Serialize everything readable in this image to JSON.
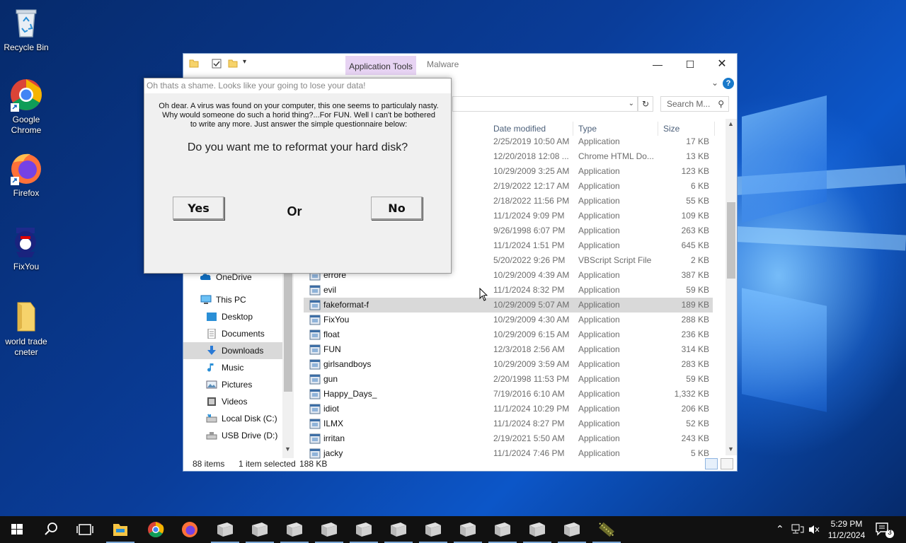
{
  "desktop": {
    "icons": [
      {
        "label": "Recycle Bin",
        "icon": "recycle-bin-icon"
      },
      {
        "label": "Google Chrome",
        "icon": "chrome-icon"
      },
      {
        "label": "Firefox",
        "icon": "firefox-icon"
      },
      {
        "label": "FixYou",
        "icon": "fixyou-icon"
      },
      {
        "label": "world trade cneter",
        "icon": "folder-icon"
      }
    ]
  },
  "explorer": {
    "ribbon_tab": "Application Tools",
    "title": "Malware",
    "search_placeholder": "Search M...",
    "columns": {
      "date": "Date modified",
      "type": "Type",
      "size": "Size"
    },
    "nav": [
      {
        "label": "OneDrive",
        "icon": "onedrive-icon"
      },
      {
        "label": "This PC",
        "icon": "pc-icon"
      },
      {
        "label": "Desktop",
        "icon": "desktop-icon"
      },
      {
        "label": "Documents",
        "icon": "documents-icon"
      },
      {
        "label": "Downloads",
        "icon": "downloads-icon",
        "selected": true
      },
      {
        "label": "Music",
        "icon": "music-icon"
      },
      {
        "label": "Pictures",
        "icon": "pictures-icon"
      },
      {
        "label": "Videos",
        "icon": "videos-icon"
      },
      {
        "label": "Local Disk (C:)",
        "icon": "drive-icon"
      },
      {
        "label": "USB Drive (D:)",
        "icon": "usb-drive-icon"
      }
    ],
    "files": [
      {
        "name": "",
        "date": "2/25/2019 10:50 AM",
        "type": "Application",
        "size": "17 KB"
      },
      {
        "name": "",
        "date": "12/20/2018 12:08 ...",
        "type": "Chrome HTML Do...",
        "size": "13 KB"
      },
      {
        "name": "",
        "date": "10/29/2009 3:25 AM",
        "type": "Application",
        "size": "123 KB"
      },
      {
        "name": "",
        "date": "2/19/2022 12:17 AM",
        "type": "Application",
        "size": "6 KB"
      },
      {
        "name": "",
        "date": "2/18/2022 11:56 PM",
        "type": "Application",
        "size": "55 KB"
      },
      {
        "name": "",
        "date": "11/1/2024 9:09 PM",
        "type": "Application",
        "size": "109 KB"
      },
      {
        "name": "",
        "date": "9/26/1998 6:07 PM",
        "type": "Application",
        "size": "263 KB"
      },
      {
        "name": "",
        "date": "11/1/2024 1:51 PM",
        "type": "Application",
        "size": "645 KB"
      },
      {
        "name": "",
        "date": "5/20/2022 9:26 PM",
        "type": "VBScript Script File",
        "size": "2 KB"
      },
      {
        "name": "errore",
        "date": "10/29/2009 4:39 AM",
        "type": "Application",
        "size": "387 KB"
      },
      {
        "name": "evil",
        "date": "11/1/2024 8:32 PM",
        "type": "Application",
        "size": "59 KB"
      },
      {
        "name": "fakeformat-f",
        "date": "10/29/2009 5:07 AM",
        "type": "Application",
        "size": "189 KB",
        "selected": true
      },
      {
        "name": "FixYou",
        "date": "10/29/2009 4:30 AM",
        "type": "Application",
        "size": "288 KB"
      },
      {
        "name": "float",
        "date": "10/29/2009 6:15 AM",
        "type": "Application",
        "size": "236 KB"
      },
      {
        "name": "FUN",
        "date": "12/3/2018 2:56 AM",
        "type": "Application",
        "size": "314 KB"
      },
      {
        "name": "girlsandboys",
        "date": "10/29/2009 3:59 AM",
        "type": "Application",
        "size": "283 KB"
      },
      {
        "name": "gun",
        "date": "2/20/1998 11:53 PM",
        "type": "Application",
        "size": "59 KB"
      },
      {
        "name": "Happy_Days_",
        "date": "7/19/2016 6:10 AM",
        "type": "Application",
        "size": "1,332 KB"
      },
      {
        "name": "idiot",
        "date": "11/1/2024 10:29 PM",
        "type": "Application",
        "size": "206 KB"
      },
      {
        "name": "ILMX",
        "date": "11/1/2024 8:27 PM",
        "type": "Application",
        "size": "52 KB"
      },
      {
        "name": "irritan",
        "date": "2/19/2021 5:50 AM",
        "type": "Application",
        "size": "243 KB"
      },
      {
        "name": "jacky",
        "date": "11/1/2024 7:46 PM",
        "type": "Application",
        "size": "5 KB"
      }
    ],
    "status": {
      "count": "88 items",
      "selection": "1 item selected",
      "size": "188 KB"
    }
  },
  "dialog": {
    "title": "Oh thats a shame. Looks like your going to lose your data!",
    "message_line1": "Oh dear. A virus was found on your computer, this one seems to particulaly nasty.",
    "message_line2": "Why would someone do such a horid thing?...For FUN. Well I can't be bothered",
    "message_line3": "to write any more. Just answer the simple questionnaire below:",
    "question": "Do you want me to reformat your hard disk?",
    "yes_label": "Yes",
    "or_label": "Or",
    "no_label": "No"
  },
  "taskbar": {
    "time": "5:29 PM",
    "date": "11/2/2024",
    "notification_count": "3"
  },
  "colors": {
    "selection": "#d9d9d9",
    "ribbon_tab": "#e7d3f3",
    "taskbar": "#111111"
  }
}
